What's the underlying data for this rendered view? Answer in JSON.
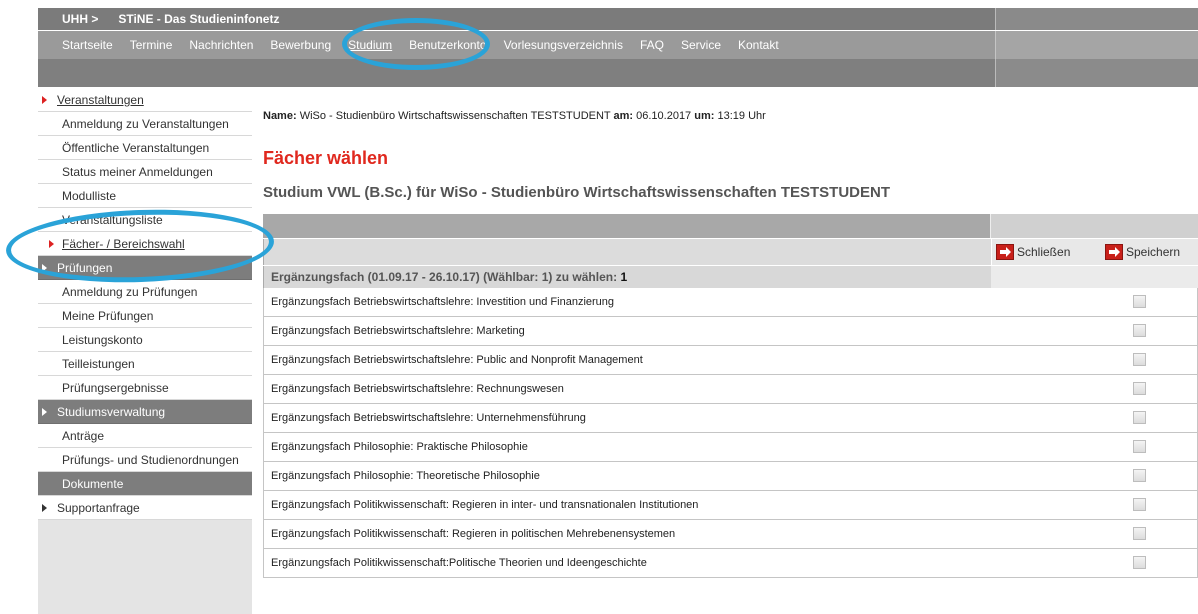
{
  "header": {
    "uhh": "UHH >",
    "site_title": "STiNE - Das Studieninfonetz"
  },
  "nav": {
    "items": [
      {
        "label": "Startseite"
      },
      {
        "label": "Termine"
      },
      {
        "label": "Nachrichten"
      },
      {
        "label": "Bewerbung"
      },
      {
        "label": "Studium"
      },
      {
        "label": "Benutzerkonto"
      },
      {
        "label": "Vorlesungsverzeichnis"
      },
      {
        "label": "FAQ"
      },
      {
        "label": "Service"
      },
      {
        "label": "Kontakt"
      }
    ],
    "active": "Studium"
  },
  "sidebar": {
    "items": [
      {
        "label": "Veranstaltungen"
      },
      {
        "label": "Anmeldung zu Veranstaltungen"
      },
      {
        "label": "Öffentliche Veranstaltungen"
      },
      {
        "label": "Status meiner Anmeldungen"
      },
      {
        "label": "Modulliste"
      },
      {
        "label": "Veranstaltungsliste"
      },
      {
        "label": "Fächer- / Bereichswahl"
      },
      {
        "label": "Prüfungen"
      },
      {
        "label": "Anmeldung zu Prüfungen"
      },
      {
        "label": "Meine Prüfungen"
      },
      {
        "label": "Leistungskonto"
      },
      {
        "label": "Teilleistungen"
      },
      {
        "label": "Prüfungsergebnisse"
      },
      {
        "label": "Studiumsverwaltung"
      },
      {
        "label": "Anträge"
      },
      {
        "label": "Prüfungs- und Studienordnungen"
      },
      {
        "label": "Dokumente"
      },
      {
        "label": "Supportanfrage"
      }
    ]
  },
  "main": {
    "name_label": "Name:",
    "name_value": "WiSo - Studienbüro Wirtschaftswissenschaften TESTSTUDENT",
    "am_label": "am:",
    "date": "06.10.2017",
    "um_label": "um:",
    "time": "13:19 Uhr",
    "title": "Fächer wählen",
    "subtitle": "Studium VWL (B.Sc.) für WiSo - Studienbüro Wirtschaftswissenschaften TESTSTUDENT",
    "close_label": "Schließen",
    "save_label": "Speichern",
    "group_label": "Ergänzungsfach (01.09.17 - 26.10.17) (Wählbar: 1) zu wählen:",
    "group_count": "1",
    "subjects": [
      {
        "label": "Ergänzungsfach Betriebswirtschaftslehre: Investition und Finanzierung",
        "checked": false
      },
      {
        "label": "Ergänzungsfach Betriebswirtschaftslehre: Marketing",
        "checked": false
      },
      {
        "label": "Ergänzungsfach Betriebswirtschaftslehre: Public and Nonprofit Management",
        "checked": false
      },
      {
        "label": "Ergänzungsfach Betriebswirtschaftslehre: Rechnungswesen",
        "checked": false
      },
      {
        "label": "Ergänzungsfach Betriebswirtschaftslehre: Unternehmensführung",
        "checked": false
      },
      {
        "label": "Ergänzungsfach Philosophie: Praktische Philosophie",
        "checked": false
      },
      {
        "label": "Ergänzungsfach Philosophie: Theoretische Philosophie",
        "checked": false
      },
      {
        "label": "Ergänzungsfach Politikwissenschaft: Regieren in inter- und transnationalen Institutionen",
        "checked": false
      },
      {
        "label": "Ergänzungsfach Politikwissenschaft: Regieren in politischen Mehrebenensystemen",
        "checked": false
      },
      {
        "label": "Ergänzungsfach Politikwissenschaft:Politische Theorien und Ideengeschichte",
        "checked": false
      }
    ]
  },
  "colors": {
    "accent_red": "#e0281e",
    "highlight_ring": "#2aa3d8"
  }
}
